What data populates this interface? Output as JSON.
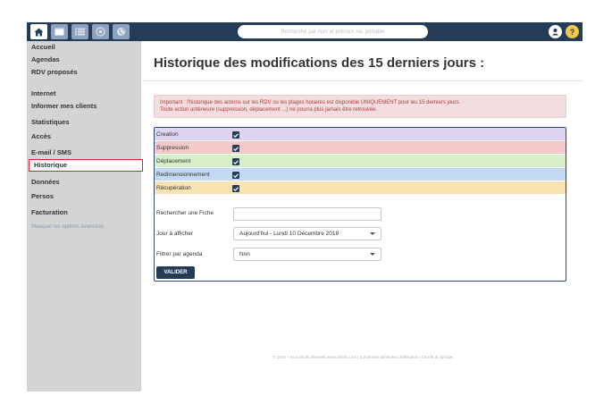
{
  "search": {
    "placeholder": "Recherche par nom et prénom, tél. portable"
  },
  "topbar_buttons": [
    "home-icon",
    "calendar-icon",
    "list-icon",
    "target-icon",
    "globe-icon"
  ],
  "user_button": "user-icon",
  "help_button": {
    "label": "?"
  },
  "sidebar": {
    "items": [
      {
        "label": "Accueil"
      },
      {
        "label": "Agendas"
      },
      {
        "label": "RDV proposés"
      },
      {
        "label": "Internet"
      },
      {
        "label": "Informer mes clients"
      },
      {
        "label": "Statistiques"
      },
      {
        "label": "Accès"
      },
      {
        "label": "E-mail / SMS"
      },
      {
        "label": "Historique"
      },
      {
        "label": "Données"
      },
      {
        "label": "Persos"
      },
      {
        "label": "Facturation"
      }
    ],
    "advanced_link": "Masquer les options avancées"
  },
  "page": {
    "title": "Historique des modifications des 15 derniers jours :"
  },
  "alert": {
    "line1": "Important : l'historique des actions sur les RDV ou les plages horaires est disponible UNIQUEMENT pour les 15 derniers jours.",
    "line2": "Toute action antérieure (suppression, déplacement ...) ne pourra plus jamais être retrouvée."
  },
  "filters": {
    "action_types": [
      {
        "label": "Creation",
        "color": "#ddd4f2",
        "checked": true
      },
      {
        "label": "Suppression",
        "color": "#f6c9c9",
        "checked": true
      },
      {
        "label": "Déplacement",
        "color": "#d6efc8",
        "checked": true
      },
      {
        "label": "Redimensionnement",
        "color": "#c5d8f3",
        "checked": true
      },
      {
        "label": "Récupération",
        "color": "#f9e3b2",
        "checked": true
      }
    ],
    "search_label": "Rechercher une Fiche",
    "search_value": "",
    "day_label": "Jour à afficher",
    "day_value": "Aujourd'hui - Lundi 10 Décembre 2018",
    "agenda_label": "Filtrer par agenda",
    "agenda_value": "Non",
    "submit_label": "VALIDER"
  },
  "footer": {
    "text": "© 2018 – Tous droits réservés www.clicrdv.com | Conditions générales d'utilisation | Charte du groupe"
  },
  "colors": {
    "navy": "#253c59",
    "sidebar": "#d4d4d4",
    "selected_border": "#d9242b"
  }
}
